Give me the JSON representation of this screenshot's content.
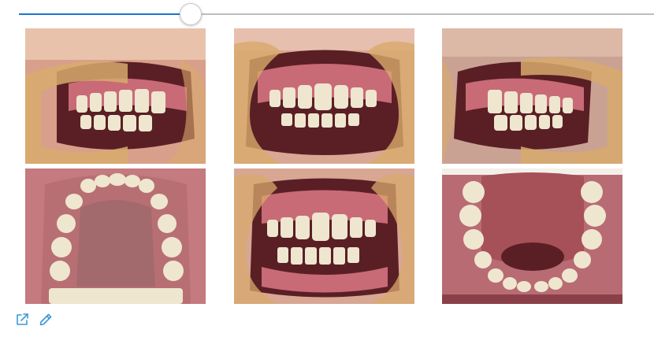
{
  "colors": {
    "accent": "#1976d2",
    "track": "#bdbdbd",
    "icon": "#3a9ad9",
    "retractor": "#d8aa6c",
    "gum": "#c96a77",
    "tooth": "#efe6cf",
    "mouth": "#5a1f25"
  },
  "slider": {
    "value_percent": 27
  },
  "photos": [
    {
      "view": "right-lateral"
    },
    {
      "view": "frontal"
    },
    {
      "view": "left-lateral"
    },
    {
      "view": "upper-occlusal"
    },
    {
      "view": "frontal-open"
    },
    {
      "view": "lower-occlusal"
    }
  ],
  "toolbar": {
    "open_icon": "external-link-icon",
    "edit_icon": "pencil-icon"
  }
}
